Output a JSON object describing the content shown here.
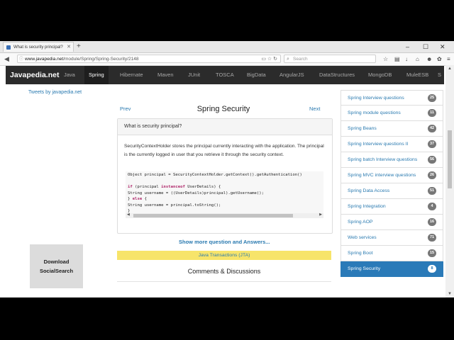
{
  "browser": {
    "tab_title": "What is security principal?",
    "url_domain": "www.javapedia.net",
    "url_path": "/module/Spring/Spring-Security/2148",
    "search_placeholder": "Search"
  },
  "nav": {
    "brand": "Javapedia.net",
    "links": [
      "Java",
      "Spring",
      "Hibernate",
      "Maven",
      "JUnit",
      "TOSCA",
      "BigData",
      "AngularJS",
      "DataStructures",
      "MongoDB",
      "MuleESB",
      "S"
    ],
    "active": "Spring"
  },
  "left": {
    "tweets_link": "Tweets by javapedia.net",
    "ad_line1": "Download",
    "ad_line2": "SocialSearch"
  },
  "main": {
    "prev": "Prev",
    "next": "Next",
    "title": "Spring Security",
    "question": "What is security principal?",
    "answer": "SecurityContextHolder stores the principal currently interacting with the application. The principal is the currently logged in user that you retrieve it through the security context.",
    "code": {
      "line1": "Object principal = SecurityContextHolder.getContext().getAuthentication()",
      "line2_kw1": "if",
      "line2_a": " (principal ",
      "line2_kw2": "instanceof",
      "line2_b": " UserDetails) {",
      "line3": "String username = ((UserDetails)principal).getUsername();",
      "line4_a": "} ",
      "line4_kw": "else",
      "line4_b": " {",
      "line5": "String username = principal.toString();",
      "line6": "}"
    },
    "show_more": "Show more question and Answers...",
    "banner": "Java Transactions (JTA)",
    "comments": "Comments & Discussions"
  },
  "sidebar": {
    "items": [
      {
        "label": "Spring Interview questions",
        "count": "25"
      },
      {
        "label": "Spring module questions",
        "count": "11"
      },
      {
        "label": "Spring Beans",
        "count": "42"
      },
      {
        "label": "Spring Interview questions II",
        "count": "37"
      },
      {
        "label": "Spring batch Interview questions",
        "count": "56"
      },
      {
        "label": "Spring MVC interview questions",
        "count": "26"
      },
      {
        "label": "Spring Data Access",
        "count": "51"
      },
      {
        "label": "Spring Integration",
        "count": "4"
      },
      {
        "label": "Spring AOP",
        "count": "16"
      },
      {
        "label": "Web services",
        "count": "71"
      },
      {
        "label": "Spring Boot",
        "count": "15"
      },
      {
        "label": "Spring Security",
        "count": "8"
      }
    ],
    "active_index": 11
  },
  "colors": {
    "nav_bg": "#2b2b2b",
    "link": "#2a7ab0",
    "active_item": "#2a7ab8",
    "banner": "#f7e46a"
  }
}
